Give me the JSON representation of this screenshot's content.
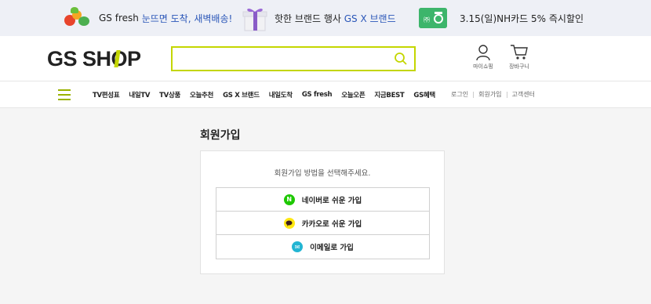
{
  "promo": {
    "item1": {
      "text": "GS fresh",
      "highlight": "눈뜨면 도착, 새벽배송!"
    },
    "item2": {
      "text": "핫한 브랜드 행사",
      "highlight": "GS X 브랜드"
    },
    "item3": {
      "text": "3.15(일)NH카드 5% 즉시할인",
      "card_label": "㈜"
    }
  },
  "header": {
    "logo": {
      "part1": "GS SH",
      "part2": "P"
    },
    "search": {
      "placeholder": "",
      "value": ""
    },
    "mypage_label": "마이쇼핑",
    "cart_label": "장바구니"
  },
  "nav": {
    "items": [
      "TV편성표",
      "내일TV",
      "TV상품",
      "오늘추천",
      "GS X 브랜드",
      "내일도착",
      "GS fresh",
      "오늘오픈",
      "지금BEST",
      "GS혜택"
    ],
    "right": [
      "로그인",
      "회원가입",
      "고객센터"
    ]
  },
  "main": {
    "title": "회원가입",
    "description": "회원가입 방법을 선택해주세요.",
    "options": [
      {
        "label": "네이버로 쉬운 가입",
        "icon": "naver-icon",
        "icon_text": "N",
        "color": "#1ec800"
      },
      {
        "label": "카카오로 쉬운 가입",
        "icon": "kakao-icon",
        "icon_text": "",
        "color": "#ffe812"
      },
      {
        "label": "이메일로 가입",
        "icon": "email-icon",
        "icon_text": "✉",
        "color": "#22b5d3"
      }
    ]
  },
  "colors": {
    "brand_accent": "#c4d600",
    "promo_bg": "#eef0f6",
    "link_blue": "#2a56b8"
  }
}
